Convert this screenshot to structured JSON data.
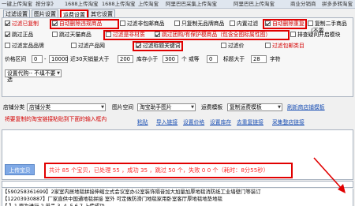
{
  "top_tabs": [
    "一键上传淘宝",
    "按分享》",
    "1688上传淘宝",
    "1688上传淘宝",
    "上传淘宝",
    "阿里巴巴采集上传淘宝",
    "阿里巴巴上传淘宝",
    "商业分销商",
    "拼多多转淘宝",
    "一键复制分销宝贝"
  ],
  "settings_tabs": [
    "过滤设置",
    "图片设置",
    "运费设置",
    "其它设置"
  ],
  "active_settings_tab": "运费设置",
  "checkboxes": {
    "r1": [
      {
        "label": "过滤已复制",
        "checked": true,
        "red": true
      },
      {
        "label": "自动删除违规商品",
        "checked": true,
        "red": true
      },
      {
        "label": "过滤非包邮商品",
        "checked": false,
        "red": false
      },
      {
        "label": "只复制无品牌商品",
        "checked": false,
        "red": false
      },
      {
        "label": "内置过滤",
        "checked": false,
        "red": false
      },
      {
        "label": "自动删除重复",
        "checked": true,
        "red": true
      },
      {
        "label": "复制二手商品（不要",
        "checked": false,
        "red": false
      }
    ],
    "r2": [
      {
        "label": "跳过正品",
        "checked": true,
        "red": false
      },
      {
        "label": "跳过天猫商品",
        "checked": false,
        "red": false
      },
      {
        "label": "过滤是非材质",
        "checked": false,
        "red": true
      },
      {
        "label": "跳过团购/有保护模商品（包含全图标属性图）",
        "checked": true,
        "red": true
      },
      {
        "label": "排查疑问开启模块",
        "checked": false,
        "red": false
      }
    ],
    "r3": [
      {
        "label": "过滤定品品牌",
        "checked": false,
        "red": false
      },
      {
        "label": "过滤产品网",
        "checked": false,
        "red": false
      },
      {
        "label": "过滤标题关键词",
        "checked": true,
        "red": false
      },
      {
        "label": "过滤价",
        "checked": false,
        "red": false
      },
      {
        "label": "过滤包邮类目",
        "checked": false,
        "red": true
      }
    ]
  },
  "price_row": {
    "price_label": "价格区间",
    "price_from": "0",
    "price_to": "10000",
    "sales_label": "近30天销量大于",
    "sales_value": "200",
    "stock_label": "库存小于",
    "stock_value": "300",
    "cn_label": "个 或等",
    "cn_value": "0",
    "title_len_label": "标题大于",
    "title_len_value": "28",
    "char_label": "字符"
  },
  "proxy_select": "设置代购-- 不填不要选",
  "store_row": {
    "shop_label": "店铺分类",
    "shop_value": "店铺分类",
    "image_label": "图片空间",
    "image_value": "淘宝助手图片",
    "freight_label": "运费模板",
    "freight_value": "复制运费模板",
    "refresh_link": "刷新商店铺模板"
  },
  "instruction": "将要复制的淘宝链接粘贴到下面的输入框内",
  "links": [
    "粘贴",
    "导入链接",
    "设置价格",
    "设置库存",
    "去重复链接",
    "采集整店链接"
  ],
  "upload_button": "上传宝贝",
  "status_text": "共计 85 个宝贝，已处理 55 ，成功 35 ，跳过 50 个，失败 0 0 个（耗时：8分55秒）",
  "log_lines": [
    "【590258361699】2家室内居地毯拼接伸缩立式会议室办公室装饰隔音加大加量加厚地毯消防纸工业墙壁门等装订",
    "【12203930887】厂家直供中国通地毯拼接 室外 可定做防滑门地毯家用卧室客厅厚地毯地垫地毯",
    "【 】1.原为进行 2.单品 3. 4. 5.6.7.上传成功"
  ]
}
